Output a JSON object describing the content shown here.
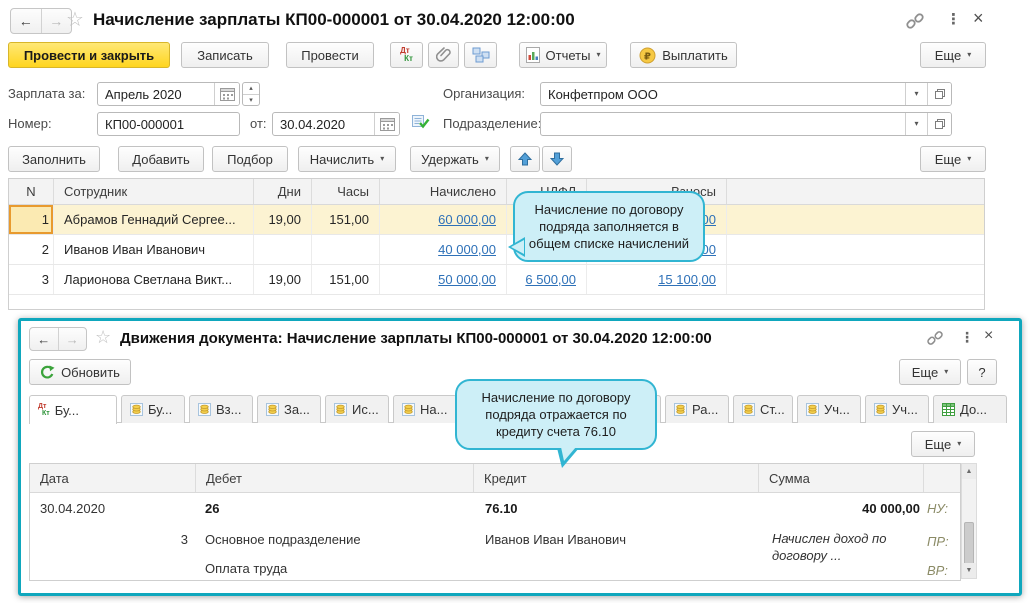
{
  "icons": {
    "back_arrow": "←",
    "forward_arrow": "→",
    "star": "☆",
    "menu_dots": "⋮",
    "close": "×",
    "caret_down": "▾",
    "spin_up": "▴",
    "spin_down": "▾",
    "scroll_up": "▲",
    "scroll_down": "▼",
    "dt": "Дт",
    "kt": "Кт"
  },
  "colors": {
    "primary_button": "#ffd51f",
    "callout_bg": "#cdeff7",
    "callout_border": "#31b5d2",
    "link": "#2e71b8",
    "window2_border": "#0fa7bd",
    "selected_row": "#fcf3d2"
  },
  "window1": {
    "title": "Начисление зарплаты КП00-000001 от 30.04.2020 12:00:00",
    "toolbar": {
      "post_and_close": "Провести и закрыть",
      "write": "Записать",
      "post": "Провести",
      "reports": "Отчеты",
      "pay": "Выплатить",
      "more": "Еще"
    },
    "form": {
      "salary_for_label": "Зарплата за:",
      "salary_for_value": "Апрель 2020",
      "organization_label": "Организация:",
      "organization_value": "Конфетпром ООО",
      "number_label": "Номер:",
      "number_value": "КП00-000001",
      "date_label": "от:",
      "date_value": "30.04.2020",
      "department_label": "Подразделение:",
      "department_value": ""
    },
    "commands": {
      "fill": "Заполнить",
      "add": "Добавить",
      "pick": "Подбор",
      "accrue": "Начислить",
      "withhold": "Удержать",
      "more": "Еще"
    },
    "table": {
      "headers": {
        "n": "N",
        "employee": "Сотрудник",
        "days": "Дни",
        "hours": "Часы",
        "accrued": "Начислено",
        "ndfl": "НДФЛ",
        "contributions": "Взносы"
      },
      "rows": [
        {
          "n": "1",
          "employee": "Абрамов Геннадий Сергее...",
          "days": "19,00",
          "hours": "151,00",
          "accrued": "60 000,00",
          "ndfl": "",
          "contributions": "120,00"
        },
        {
          "n": "2",
          "employee": "Иванов Иван Иванович",
          "days": "",
          "hours": "",
          "accrued": "40 000,00",
          "ndfl": "",
          "contributions": "840,00"
        },
        {
          "n": "3",
          "employee": "Ларионова Светлана Викт...",
          "days": "19,00",
          "hours": "151,00",
          "accrued": "50 000,00",
          "ndfl": "6 500,00",
          "contributions": "15 100,00"
        }
      ]
    },
    "callout": {
      "text": "Начисление по договору подряда заполняется в общем списке начислений"
    }
  },
  "window2": {
    "title": "Движения документа: Начисление зарплаты КП00-000001 от 30.04.2020 12:00:00",
    "toolbar": {
      "refresh": "Обновить",
      "more": "Еще",
      "help": "?"
    },
    "tabs": [
      "Бу...",
      "Бу...",
      "Вз...",
      "За...",
      "Ис...",
      "На...",
      "...",
      "Ра...",
      "Ст...",
      "Уч...",
      "Уч...",
      "До..."
    ],
    "more2": "Еще",
    "table": {
      "headers": {
        "date": "Дата",
        "debit": "Дебет",
        "credit": "Кредит",
        "sum": "Сумма"
      },
      "entry": {
        "date": "30.04.2020",
        "line": "3",
        "debit_account": "26",
        "debit_dept": "Основное подразделение",
        "debit_item": "Оплата труда",
        "credit_account": "76.10",
        "credit_person": "Иванов Иван Иванович",
        "sum": "40 000,00",
        "sum_comment": "Начислен доход по договору ...",
        "nu": "НУ:",
        "pr": "ПР:",
        "vr": "ВР:"
      }
    },
    "callout": {
      "text": "Начисление по договору подряда отражается по кредиту счета 76.10"
    }
  }
}
